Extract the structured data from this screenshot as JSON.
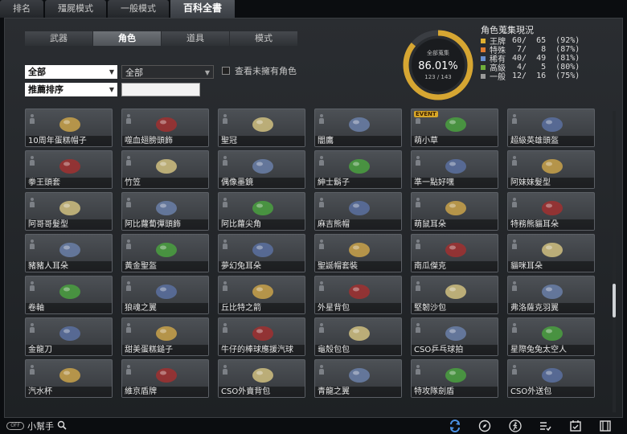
{
  "top_tabs": [
    "排名",
    "殭屍模式",
    "一般模式",
    "百科全書"
  ],
  "sub_tabs": [
    "武器",
    "角色",
    "道具",
    "模式"
  ],
  "filters": {
    "category_value": "全部",
    "subcategory_value": "全部",
    "sort_value": "推薦排序",
    "search_value": "",
    "show_unowned_label": "查看未擁有角色"
  },
  "collection": {
    "title": "角色蒐集現況",
    "donut_label": "全部蒐集",
    "donut_percent": "86.01%",
    "donut_count": "123 / 143",
    "progress": 0.8601,
    "rows": [
      {
        "name": "王牌",
        "text": "60/  65  (92%)",
        "color": "#e0b030"
      },
      {
        "name": "特殊",
        "text": " 7/   8  (87%)",
        "color": "#e07a30"
      },
      {
        "name": "稀有",
        "text": "40/  49  (81%)",
        "color": "#6a8fd0"
      },
      {
        "name": "高級",
        "text": " 4/   5  (80%)",
        "color": "#6fae3a"
      },
      {
        "name": "一般",
        "text": "12/  16  (75%)",
        "color": "#9a9a9a"
      }
    ]
  },
  "items": [
    {
      "label": "10周年蛋糕帽子"
    },
    {
      "label": "噬血翅膀頭飾"
    },
    {
      "label": "聖冠"
    },
    {
      "label": "闇鷹"
    },
    {
      "label": "萌小草",
      "badge": "EVENT"
    },
    {
      "label": "超級英雄頭盔"
    },
    {
      "label": "拳王頭套"
    },
    {
      "label": "竹笠"
    },
    {
      "label": "偶像墨鏡"
    },
    {
      "label": "紳士鬍子"
    },
    {
      "label": "準一點好嘿"
    },
    {
      "label": "阿妹妹髮型"
    },
    {
      "label": "阿哥哥髮型"
    },
    {
      "label": "阿比蘿蔔彈頭飾"
    },
    {
      "label": "阿比蘿尖角"
    },
    {
      "label": "麻吉熊帽"
    },
    {
      "label": "萌鼠耳朵"
    },
    {
      "label": "特務熊貓耳朵"
    },
    {
      "label": "豬豬人耳朵"
    },
    {
      "label": "黃金聖盔"
    },
    {
      "label": "夢幻兔耳朵"
    },
    {
      "label": "聖誕帽套裝"
    },
    {
      "label": "南瓜傑克"
    },
    {
      "label": "貓咪耳朵"
    },
    {
      "label": "卷軸"
    },
    {
      "label": "狼魂之翼"
    },
    {
      "label": "丘比特之箭"
    },
    {
      "label": "外星背包"
    },
    {
      "label": "堅韌沙包"
    },
    {
      "label": "弗洛薩克羽翼"
    },
    {
      "label": "金龍刀"
    },
    {
      "label": "甜美蛋糕鎚子"
    },
    {
      "label": "牛仔的棒球應援汽球"
    },
    {
      "label": "龜殼包包"
    },
    {
      "label": "CSO乒乓球拍"
    },
    {
      "label": "星際兔兔太空人"
    },
    {
      "label": "汽水杯"
    },
    {
      "label": "維京盾牌"
    },
    {
      "label": "CSO外賣背包"
    },
    {
      "label": "青龍之翼"
    },
    {
      "label": "特攻隊劍盾"
    },
    {
      "label": "CSO外送包"
    }
  ],
  "bottom": {
    "toggle_text": "OFF",
    "helper_label": "小幫手"
  }
}
